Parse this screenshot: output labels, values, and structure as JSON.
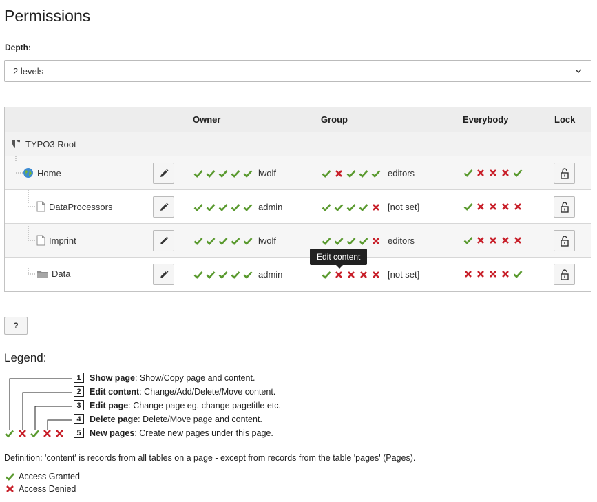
{
  "page": {
    "title": "Permissions"
  },
  "depth": {
    "label": "Depth:",
    "selected": "2 levels"
  },
  "table": {
    "headers": {
      "owner": "Owner",
      "group": "Group",
      "everybody": "Everybody",
      "lock": "Lock"
    },
    "root": {
      "label": "TYPO3 Root"
    },
    "rows": [
      {
        "name": "Home",
        "owner_perms": [
          1,
          1,
          1,
          1,
          1
        ],
        "owner": "lwolf",
        "group_perms": [
          1,
          0,
          1,
          1,
          1
        ],
        "group": "editors",
        "everybody_perms": [
          1,
          0,
          0,
          0,
          1
        ]
      },
      {
        "name": "DataProcessors",
        "owner_perms": [
          1,
          1,
          1,
          1,
          1
        ],
        "owner": "admin",
        "group_perms": [
          1,
          1,
          1,
          1,
          0
        ],
        "group": "[not set]",
        "everybody_perms": [
          1,
          0,
          0,
          0,
          0
        ]
      },
      {
        "name": "Imprint",
        "owner_perms": [
          1,
          1,
          1,
          1,
          1
        ],
        "owner": "lwolf",
        "group_perms": [
          1,
          1,
          1,
          1,
          0
        ],
        "group": "editors",
        "everybody_perms": [
          1,
          0,
          0,
          0,
          0
        ]
      },
      {
        "name": "Data",
        "owner_perms": [
          1,
          1,
          1,
          1,
          1
        ],
        "owner": "admin",
        "group_perms": [
          1,
          0,
          0,
          0,
          0
        ],
        "group": "[not set]",
        "everybody_perms": [
          0,
          0,
          0,
          0,
          1
        ]
      }
    ]
  },
  "tooltip": {
    "text": "Edit content"
  },
  "help_button": {
    "label": "?"
  },
  "legend": {
    "title": "Legend:",
    "items": [
      {
        "num": "1",
        "name": "Show page",
        "desc": ": Show/Copy page and content."
      },
      {
        "num": "2",
        "name": "Edit content",
        "desc": ": Change/Add/Delete/Move content."
      },
      {
        "num": "3",
        "name": "Edit page",
        "desc": ": Change page eg. change pagetitle etc."
      },
      {
        "num": "4",
        "name": "Delete page",
        "desc": ": Delete/Move page and content."
      },
      {
        "num": "5",
        "name": "New pages",
        "desc": ": Create new pages under this page."
      }
    ],
    "definition": "Definition: 'content' is records from all tables on a page - except from records from the table 'pages' (Pages).",
    "granted": "Access Granted",
    "denied": "Access Denied"
  },
  "colors": {
    "granted": "#5a9a2f",
    "denied": "#c8202a"
  },
  "icons": {
    "edit": "pencil-icon",
    "lock": "unlock-icon",
    "typo3": "typo3-logo-icon",
    "globe": "globe-icon",
    "page": "page-icon",
    "folder": "folder-icon"
  }
}
